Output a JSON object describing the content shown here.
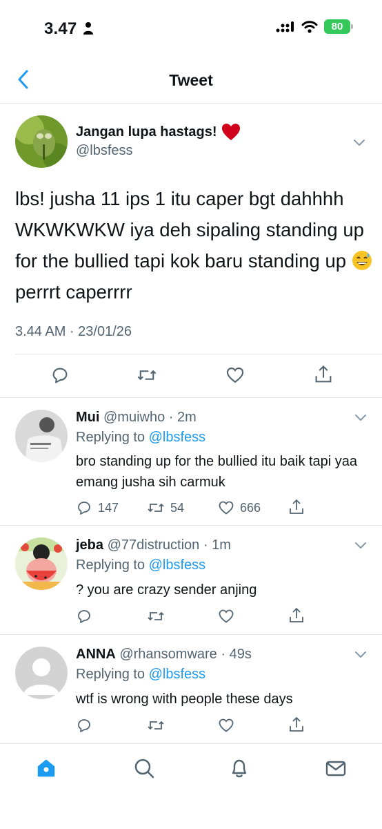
{
  "status_bar": {
    "time": "3.47",
    "battery": "80"
  },
  "nav": {
    "title": "Tweet"
  },
  "main_tweet": {
    "display_name": "Jangan lupa hastags!",
    "handle": "@lbsfess",
    "text_before_emoji": "lbs! jusha 11 ips 1 itu caper bgt dahhhh WKWKWKW iya deh sipaling standing up for the bullied tapi kok baru standing up",
    "text_after_emoji": " perrrt caperrrr",
    "timestamp": "3.44 AM · 23/01/26"
  },
  "replies": [
    {
      "name": "Mui",
      "handle": "@muiwho",
      "time": "2m",
      "replying_label": "Replying to",
      "replying_to": "@lbsfess",
      "text": "bro standing up for the bullied itu baik tapi yaa emang jusha sih carmuk",
      "reply_count": "147",
      "retweet_count": "54",
      "like_count": "666"
    },
    {
      "name": "jeba",
      "handle": "@77distruction",
      "time": "1m",
      "replying_label": "Replying to",
      "replying_to": "@lbsfess",
      "text": "? you are crazy sender anjing"
    },
    {
      "name": "ANNA",
      "handle": "@rhansomware",
      "time": "49s",
      "replying_label": "Replying to",
      "replying_to": "@lbsfess",
      "text": "wtf is wrong with people these days"
    }
  ],
  "tabs": [
    "home-icon",
    "search-icon",
    "notifications-icon",
    "messages-icon"
  ],
  "colors": {
    "accent": "#1d9bf0",
    "secondary_text": "#536471",
    "heart": "#e0245e",
    "battery": "#34c759"
  }
}
